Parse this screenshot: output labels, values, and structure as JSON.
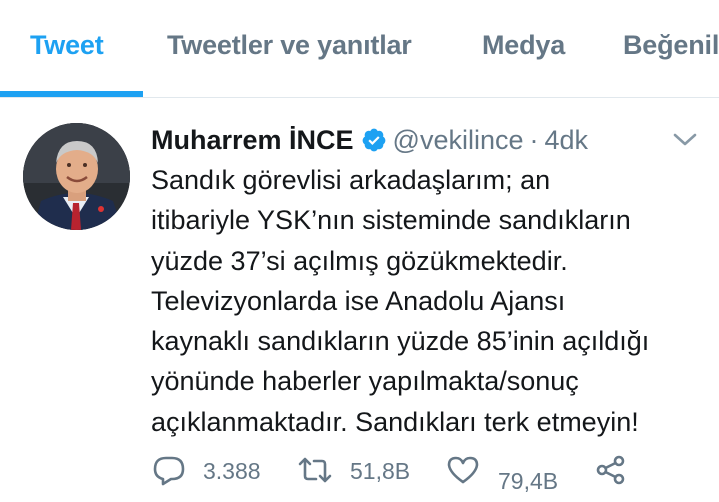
{
  "tabs": [
    {
      "label": "Tweet",
      "active": true
    },
    {
      "label": "Tweetler ve yanıtlar",
      "active": false
    },
    {
      "label": "Medya",
      "active": false
    },
    {
      "label": "Beğenile",
      "active": false
    }
  ],
  "tweet": {
    "author_name": "Muharrem İNCE",
    "handle": "@vekilince",
    "separator": "·",
    "time": "4dk",
    "text": "Sandık görevlisi arkadaşlarım; an\nitibariyle YSK’nın sisteminde sandıkların\nyüzde 37’si açılmış gözükmektedir.\nTelevizyonlarda ise Anadolu Ajansı\nkaynaklı sandıkların yüzde 85’inin açıldığı\nyönünde haberler yapılmakta/sonuç\naçıklanmaktadır. Sandıkları terk etmeyin!"
  },
  "actions": {
    "reply_count": "3.388",
    "retweet_count": "51,8B",
    "like_count": "79,4B"
  },
  "colors": {
    "accent": "#1da1f2",
    "text": "#14171a",
    "muted": "#657786"
  },
  "icons": [
    "verified-icon",
    "chevron-down-icon",
    "reply-icon",
    "retweet-icon",
    "like-icon",
    "share-icon"
  ]
}
